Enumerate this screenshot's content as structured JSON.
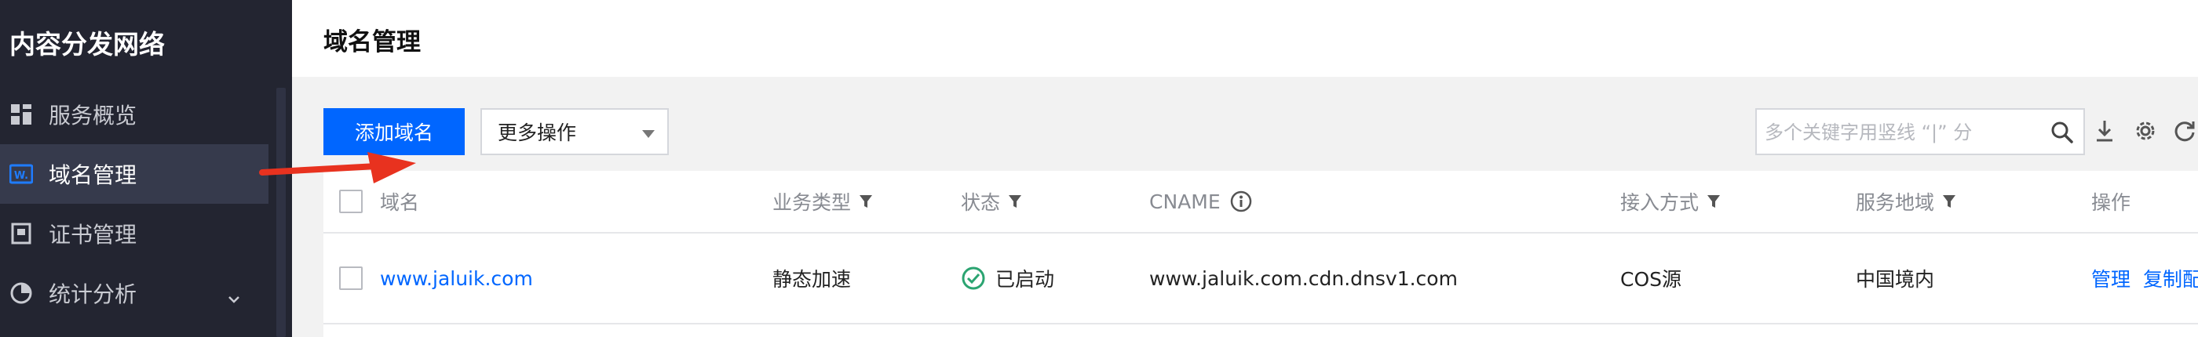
{
  "sidebar": {
    "title": "内容分发网络",
    "items": [
      {
        "label": "服务概览",
        "icon": "grid-icon"
      },
      {
        "label": "域名管理",
        "icon": "domain-icon",
        "active": true
      },
      {
        "label": "证书管理",
        "icon": "certificate-icon"
      },
      {
        "label": "统计分析",
        "icon": "pie-chart-icon",
        "expandable": true
      }
    ]
  },
  "header": {
    "title": "域名管理"
  },
  "toolbar": {
    "add_label": "添加域名",
    "more_label": "更多操作",
    "search_placeholder": "多个关键字用竖线 “|” 分"
  },
  "table": {
    "columns": [
      "域名",
      "业务类型",
      "状态",
      "CNAME",
      "接入方式",
      "服务地域",
      "操作"
    ],
    "rows": [
      {
        "domain": "www.jaluik.com",
        "type": "静态加速",
        "status": "已启动",
        "cname": "www.jaluik.com.cdn.dnsv1.com",
        "access": "COS源",
        "region": "中国境内",
        "actions": [
          "管理",
          "复制配置"
        ]
      }
    ]
  },
  "colors": {
    "accent": "#0066ff",
    "sidebar_bg": "#232531",
    "active_bg": "#363a4c",
    "success": "#2ba471",
    "arrow": "#e8321f"
  }
}
